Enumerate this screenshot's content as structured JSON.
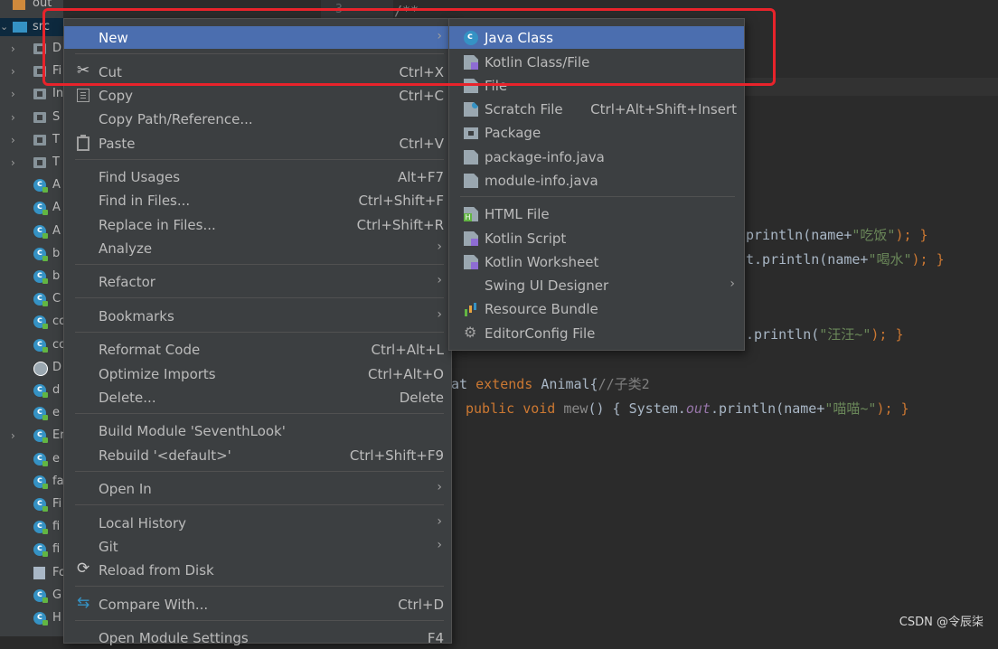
{
  "tree": {
    "out_label": "out",
    "src_label": "src",
    "rows": [
      {
        "arrow": "›",
        "icon": "folder",
        "text": "D"
      },
      {
        "arrow": "›",
        "icon": "folder",
        "text": "Fi"
      },
      {
        "arrow": "›",
        "icon": "folder",
        "text": "In"
      },
      {
        "arrow": "›",
        "icon": "folder",
        "text": "S"
      },
      {
        "arrow": "›",
        "icon": "folder",
        "text": "T"
      },
      {
        "arrow": "›",
        "icon": "folder",
        "text": "T"
      },
      {
        "arrow": "",
        "icon": "class",
        "text": "A"
      },
      {
        "arrow": "",
        "icon": "class",
        "text": "A"
      },
      {
        "arrow": "",
        "icon": "class",
        "text": "A"
      },
      {
        "arrow": "",
        "icon": "class",
        "text": "b"
      },
      {
        "arrow": "",
        "icon": "class",
        "text": "b"
      },
      {
        "arrow": "",
        "icon": "class",
        "text": "C"
      },
      {
        "arrow": "",
        "icon": "class",
        "text": "co"
      },
      {
        "arrow": "",
        "icon": "class",
        "text": "co"
      },
      {
        "arrow": "",
        "icon": "abstract",
        "text": "D"
      },
      {
        "arrow": "",
        "icon": "class",
        "text": "d"
      },
      {
        "arrow": "",
        "icon": "class",
        "text": "e"
      },
      {
        "arrow": "›",
        "icon": "class",
        "text": "Er"
      },
      {
        "arrow": "",
        "icon": "class",
        "text": "e"
      },
      {
        "arrow": "",
        "icon": "class",
        "text": "fa"
      },
      {
        "arrow": "",
        "icon": "class",
        "text": "Fi"
      },
      {
        "arrow": "",
        "icon": "class",
        "text": "fi"
      },
      {
        "arrow": "",
        "icon": "class",
        "text": "fi"
      },
      {
        "arrow": "",
        "icon": "form",
        "text": "Fo"
      },
      {
        "arrow": "",
        "icon": "class",
        "text": "G"
      },
      {
        "arrow": "",
        "icon": "class",
        "text": "H"
      }
    ]
  },
  "editor": {
    "gutter_line": "3",
    "line1": "/**",
    "code1_pre": "println(name+",
    "code1_str": "\"吃饭\"",
    "code1_post": "); }",
    "code2_pre": "t.println(name+",
    "code2_str": "\"喝水\"",
    "code2_post": "); }",
    "code3_pre": ".println(",
    "code3_str": "\"汪汪~\"",
    "code3_post": "); }",
    "code4_a": "Cat ",
    "code4_kw": "extends",
    "code4_b": " Animal{",
    "code4_cm": "//子类2",
    "code5_kw1": "public",
    "code5_kw2": " void",
    "code5_fn": " mew",
    "code5_a": "() { System.",
    "code5_out": "out",
    "code5_b": ".println(name+",
    "code5_str": "\"喵喵~\"",
    "code5_c": "); }"
  },
  "context_menu": {
    "new": "New",
    "cut": "Cut",
    "cut_sc": "Ctrl+X",
    "copy": "Copy",
    "copy_sc": "Ctrl+C",
    "copy_path": "Copy Path/Reference...",
    "paste": "Paste",
    "paste_sc": "Ctrl+V",
    "find_usages": "Find Usages",
    "find_usages_sc": "Alt+F7",
    "find_in_files": "Find in Files...",
    "find_in_files_sc": "Ctrl+Shift+F",
    "replace_in_files": "Replace in Files...",
    "replace_in_files_sc": "Ctrl+Shift+R",
    "analyze": "Analyze",
    "refactor": "Refactor",
    "bookmarks": "Bookmarks",
    "reformat_code": "Reformat Code",
    "reformat_code_sc": "Ctrl+Alt+L",
    "optimize_imports": "Optimize Imports",
    "optimize_imports_sc": "Ctrl+Alt+O",
    "delete": "Delete...",
    "delete_sc": "Delete",
    "build_module": "Build Module 'SeventhLook'",
    "rebuild": "Rebuild '<default>'",
    "rebuild_sc": "Ctrl+Shift+F9",
    "open_in": "Open In",
    "local_history": "Local History",
    "git": "Git",
    "reload": "Reload from Disk",
    "compare_with": "Compare With...",
    "compare_with_sc": "Ctrl+D",
    "open_module_settings": "Open Module Settings",
    "open_module_settings_sc": "F4"
  },
  "new_menu": {
    "java_class": "Java Class",
    "kotlin_class": "Kotlin Class/File",
    "file": "File",
    "scratch_file": "Scratch File",
    "scratch_file_sc": "Ctrl+Alt+Shift+Insert",
    "package": "Package",
    "package_info": "package-info.java",
    "module_info": "module-info.java",
    "html_file": "HTML File",
    "kotlin_script": "Kotlin Script",
    "kotlin_worksheet": "Kotlin Worksheet",
    "swing_ui": "Swing UI Designer",
    "resource_bundle": "Resource Bundle",
    "editorconfig": "EditorConfig File"
  },
  "watermark": "CSDN @令辰柒",
  "colors": {
    "selection": "#4b6eaf",
    "menu_bg": "#3c3f41",
    "highlight_box": "#e8232b"
  }
}
